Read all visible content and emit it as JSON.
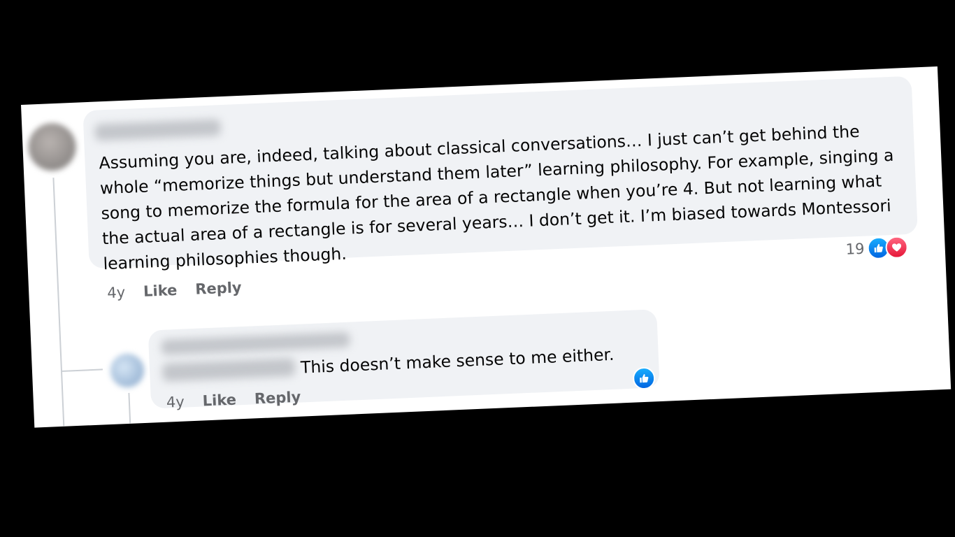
{
  "comment": {
    "text": "Assuming you are, indeed, talking about classical conversations… I just can’t get behind the whole “memorize things but understand them later” learning philosophy. For example, singing a song to memorize the formula for the area of a rectangle when you’re 4. But not learning what the actual area of a rectangle is for several years… I don’t get it. I’m biased towards Montessori learning philosophies though.",
    "time": "4y",
    "like_label": "Like",
    "reply_label": "Reply",
    "reaction_count": "19",
    "reaction_icons": [
      "like-icon",
      "love-icon"
    ]
  },
  "reply": {
    "text": "This doesn’t make sense to me either.",
    "time": "4y",
    "like_label": "Like",
    "reply_label": "Reply",
    "reaction_icons": [
      "like-icon"
    ]
  },
  "colors": {
    "bubble": "#f0f2f5",
    "meta_text": "#65676b",
    "like_blue": "#0866ff",
    "love_red": "#f33e58"
  }
}
